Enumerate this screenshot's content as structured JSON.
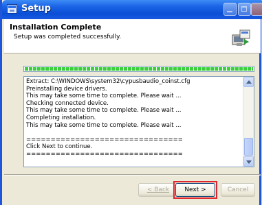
{
  "window": {
    "title": "Setup"
  },
  "header": {
    "title": "Installation Complete",
    "subtitle": "Setup was completed successfully."
  },
  "progress": {
    "fraction": 1.0
  },
  "log": {
    "lines": [
      "Extract: C:\\WINDOWS\\system32\\cypusbaudio_coinst.cfg",
      "Preinstalling device drivers.",
      "This may take some time to complete. Please wait ...",
      "Checking connected device.",
      "This may take some time to complete. Please wait ...",
      "Completing installation.",
      "This may take some time to complete. Please wait ...",
      "",
      "================================",
      "Click Next to continue.",
      "================================"
    ]
  },
  "buttons": {
    "back": "< Back",
    "next": "Next >",
    "cancel": "Cancel"
  },
  "colors": {
    "titlebar": "#0b4fd6",
    "progress": "#3ccf3c",
    "highlight": "#e0262c"
  }
}
